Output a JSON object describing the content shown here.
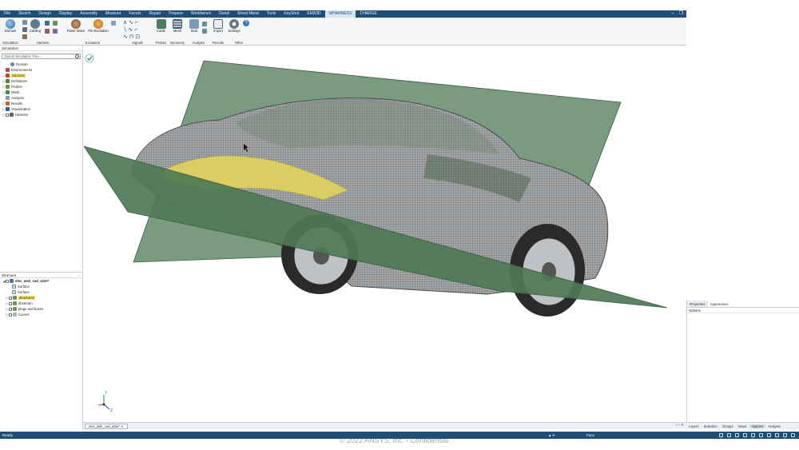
{
  "menubar": {
    "items": [
      "File",
      "Sketch",
      "Design",
      "Display",
      "Assembly",
      "Measure",
      "Facets",
      "Repair",
      "Prepare",
      "Workbench",
      "Detail",
      "Sheet Metal",
      "Tools",
      "KeyShot",
      "EMA3D",
      "WHARNESS",
      "CHARGE"
    ],
    "active": "WHARNESS"
  },
  "ribbon": {
    "groups": {
      "simulation": "Simulation",
      "harness": "Harness",
      "excitation": "Excitation",
      "signals": "Signals",
      "probes": "Probes",
      "geometry": "Geometry",
      "analysis": "Analysis",
      "results": "Results",
      "other": "Other"
    },
    "buttons": {
      "domain": "Domain",
      "cabling": "Cabling",
      "plane_wave": "Plane Wave",
      "pin_excitation": "Pin Excitation",
      "cable": "Cable",
      "mesh": "Mesh",
      "start": "Start",
      "import": "Import",
      "settings": "Settings"
    }
  },
  "simulation_panel": {
    "title": "Simulation",
    "search_placeholder": "Search Simulation Tree...",
    "tree": [
      "Domain",
      "Environments",
      "Sources",
      "Definitions",
      "Probes",
      "Mesh",
      "Analysis",
      "Results",
      "Visualization",
      "Harness"
    ]
  },
  "structure_panel": {
    "title": "Structure",
    "root": "elec_wsh_cad_wise*",
    "items": [
      "Surface",
      "Surface",
      "structures",
      "drivetrain",
      "plugs and boxes",
      "Curves"
    ]
  },
  "document_tab": "elec_wsh_cad_wise*",
  "right_panel": {
    "tabs": [
      "Properties",
      "Appearance"
    ],
    "row": "Options"
  },
  "bottom_tabs": [
    "Layers",
    "Selection",
    "Groups",
    "Views",
    "Options",
    "Analysis"
  ],
  "status": {
    "left": "Ready",
    "center": "Face"
  },
  "footer_text": "© 2022 ANSYS, Inc. / Confidential",
  "colors": {
    "menubar": "#1f4e79",
    "plane": "#4f7a55",
    "body": "#9fa1a3",
    "highlight": "#e4d65a"
  }
}
